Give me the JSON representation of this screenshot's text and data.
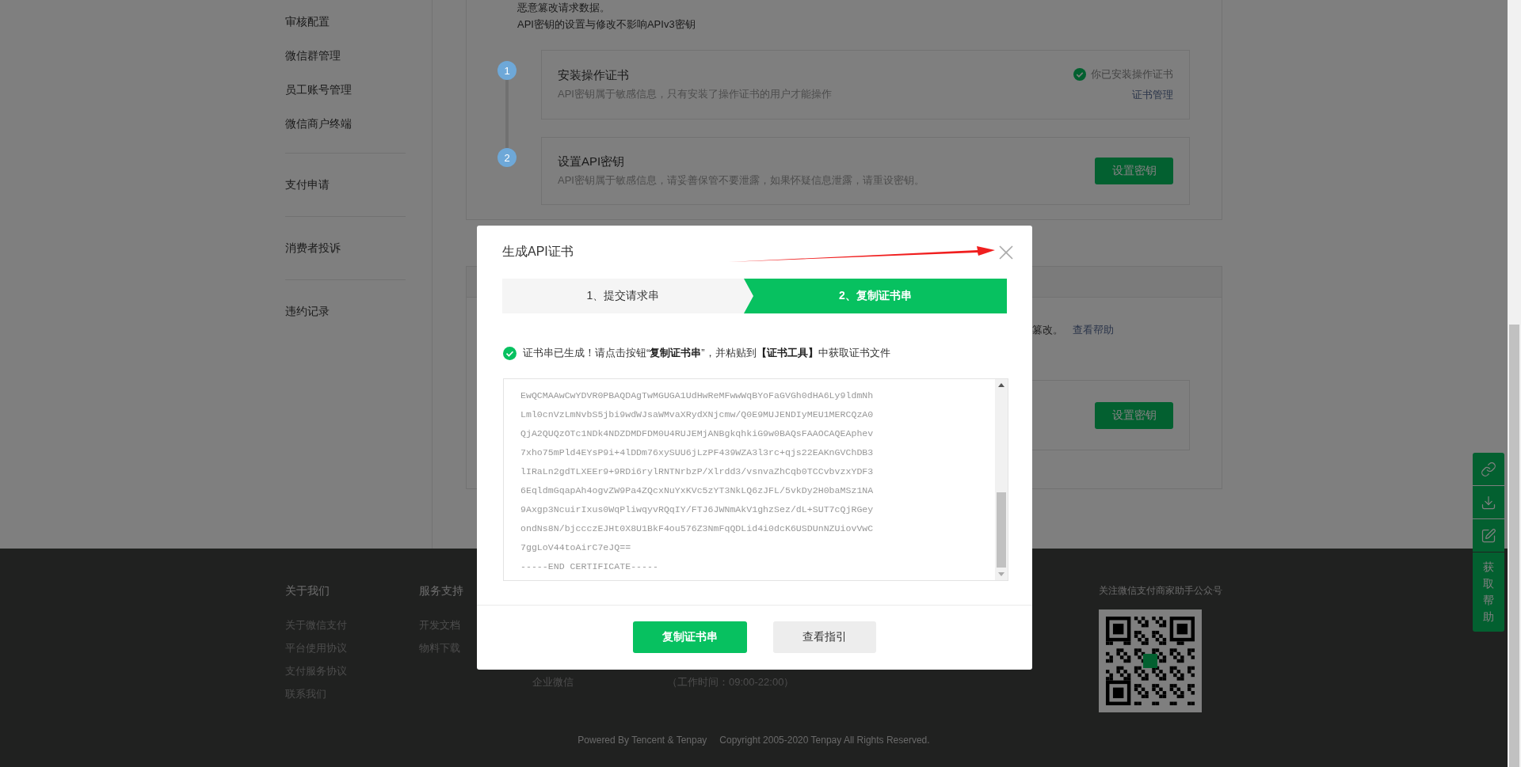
{
  "sidebar": {
    "groups": [
      {
        "items": [
          "审核配置",
          "微信群管理",
          "员工账号管理",
          "微信商户终端"
        ]
      },
      {
        "items": [
          "支付申请"
        ]
      },
      {
        "items": [
          "消费者投诉"
        ]
      },
      {
        "items": [
          "违约记录"
        ]
      }
    ]
  },
  "intro_lines": [
    "恶意篡改请求数据。",
    "API密钥的设置与修改不影响APIv3密钥"
  ],
  "steps": [
    {
      "number": "1",
      "kind": "status",
      "title": "安装操作证书",
      "description": "API密钥属于敏感信息，只有安装了操作证书的用户才能操作",
      "status": "你已安装操作证书",
      "link": "证书管理"
    },
    {
      "number": "2",
      "kind": "button",
      "title": "设置API密钥",
      "description": "API密钥属于敏感信息，请妥善保管不要泄露，如果怀疑信息泄露，请重设密钥。",
      "button": "设置密钥"
    }
  ],
  "second_card": {
    "text": "篡改。",
    "link": "查看帮助",
    "button": "设置密钥"
  },
  "modal": {
    "title": "生成API证书",
    "steps": [
      {
        "label": "1、提交请求串",
        "selected": false
      },
      {
        "label": "2、复制证书串",
        "selected": true
      }
    ],
    "message": "证书串已生成！请点击按钮“**复制证书串**”，并粘贴到**【证书工具】**中获取证书文件",
    "certificate_lines": [
      "EwQCMAAwCwYDVR0PBAQDAgTwMGUGA1UdHwReMFwwWqBYoFaGVGh0dHA6Ly9ldmNh",
      "Lml0cnVzLmNvbS5jbi9wdWJsaWMvaXRydXNjcmw/Q0E9MUJENDIyMEU1MERCQzA0",
      "QjA2QUQzOTc1NDk4NDZDMDFDM0U4RUJEMjANBgkqhkiG9w0BAQsFAAOCAQEAphev",
      "7xho75mPld4EYsP9i+4lDDm76xySUU6jLzPF439WZA3l3rc+qjs22EAKnGVChDB3",
      "lIRaLn2gdTLXEEr9+9RDi6rylRNTNrbzP/Xlrdd3/vsnvaZhCqb0TCCvbvzxYDF3",
      "6EqldmGqapAh4ogvZW9Pa4ZQcxNuYxKVc5zYT3NkLQ6zJFL/5vkDy2H0baMSz1NA",
      "9Axgp3NcuirIxus0WqPliwqyvRQqIY/FTJ6JWNmAkV1ghzSez/dL+SUT7cQjRGey",
      "ondNs8N/bjccczEJHt0X8U1BkF4ou576Z3NmFqQDLid4i0dcK6USDUnNZUiovVwC",
      "7ggLoV44toAirC7eJQ==",
      "-----END CERTIFICATE-----"
    ],
    "buttons": [
      {
        "label": "复制证书串",
        "kind": "primary"
      },
      {
        "label": "查看指引",
        "kind": "secondary"
      }
    ]
  },
  "footer": {
    "columns": [
      {
        "heading": "关于我们",
        "links": [
          "关于微信支付",
          "平台使用协议",
          "支付服务协议",
          "联系我们"
        ]
      },
      {
        "heading": "服务支持",
        "links": [
          "开发文档",
          "物料下载"
        ]
      }
    ],
    "contact": [
      "企业微信",
      "（工作时间：09:00-22:00）"
    ],
    "qr_title": "关注微信支付商家助手公众号",
    "powered": "Powered By Tencent & Tenpay",
    "copyright": "Copyright 2005-2020 Tenpay All Rights Reserved."
  },
  "help_widget": {
    "label": "获取帮助"
  }
}
